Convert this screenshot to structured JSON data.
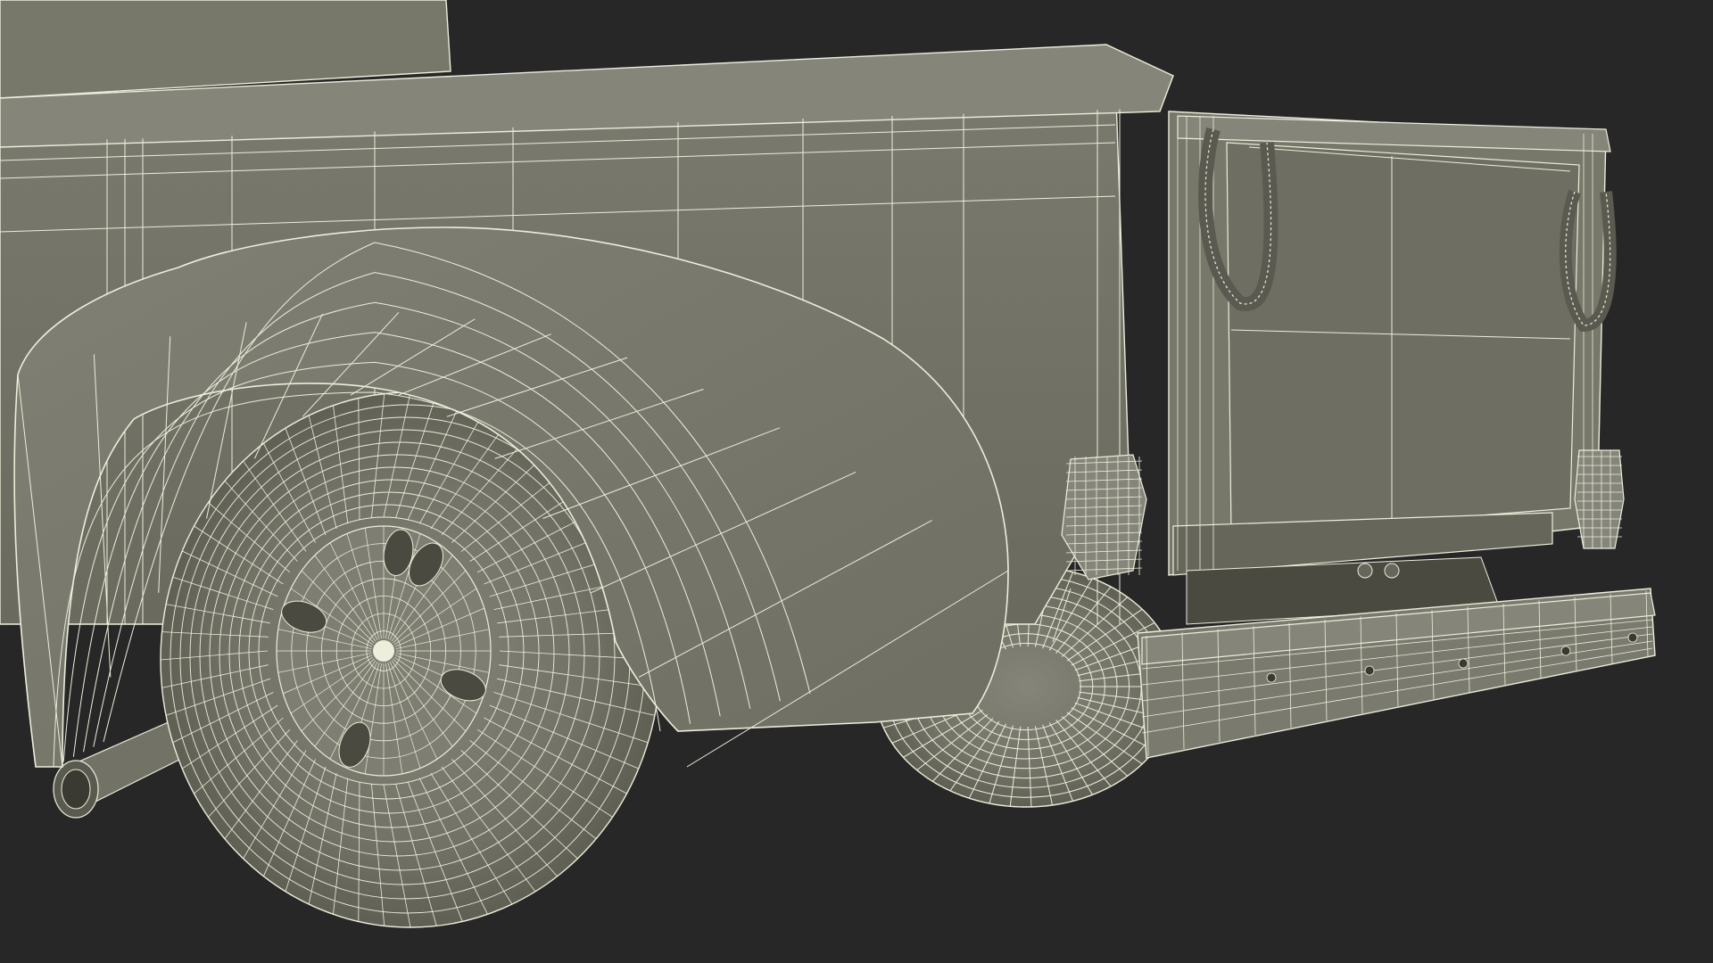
{
  "scene": {
    "subject": "wireframe-render-pickup-truck-rear",
    "colors": {
      "background": "#272727",
      "body": "#77776a",
      "body_dark": "#66665a",
      "body_light": "#85857a",
      "shadow": "#4a4a40",
      "tire": "#727266",
      "tire_dark": "#5a5a50",
      "wire": "#eeeedc"
    }
  }
}
